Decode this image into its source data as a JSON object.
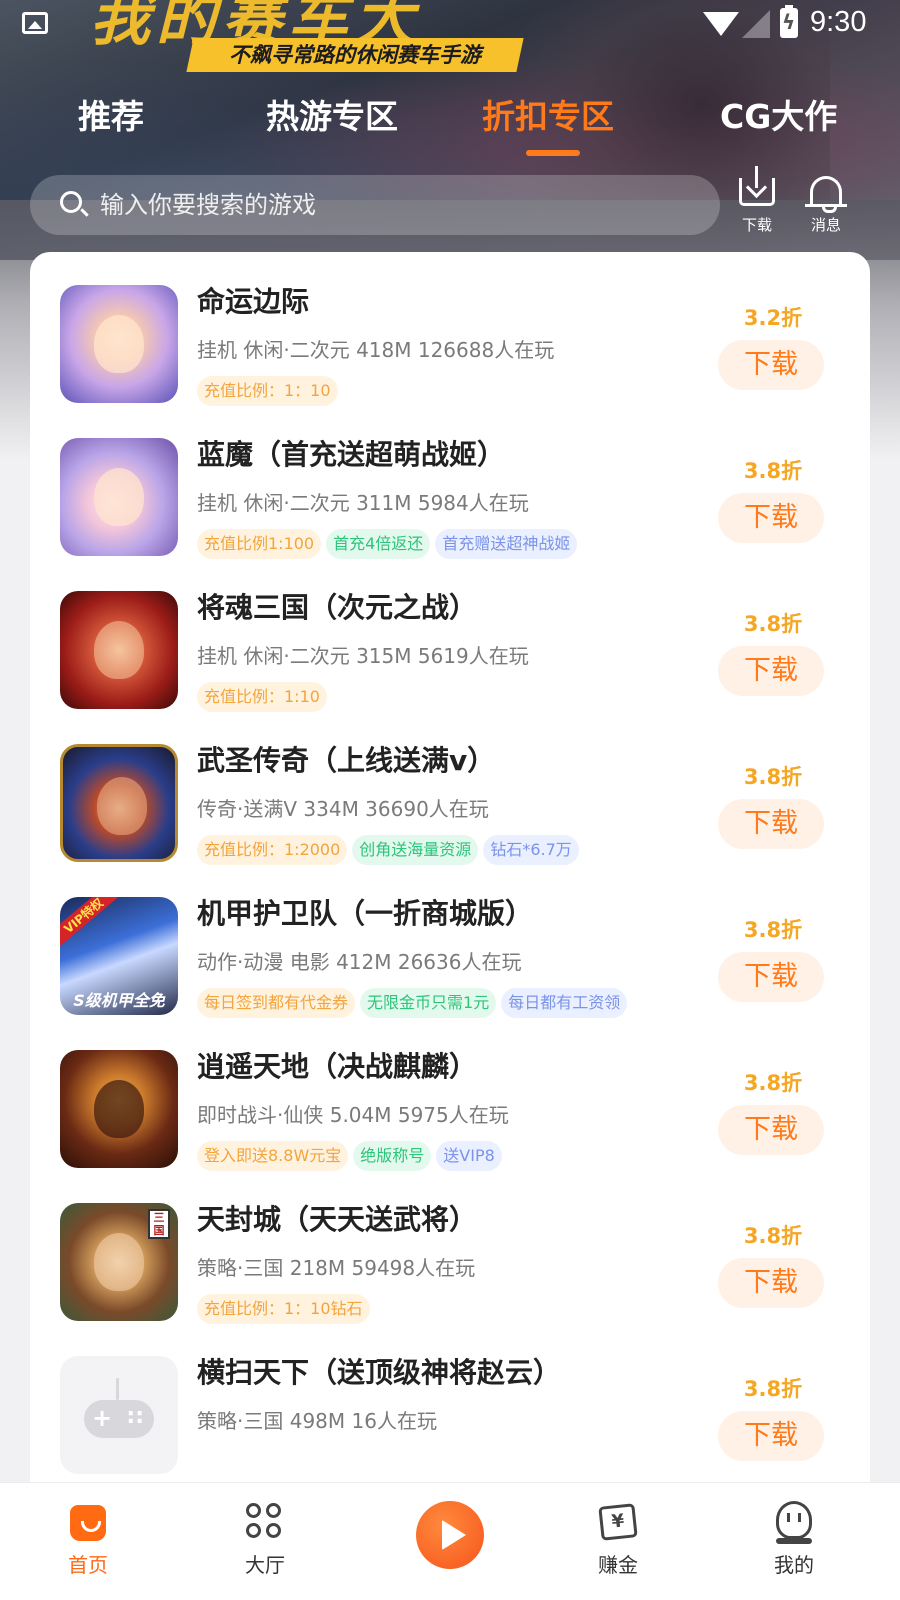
{
  "banner": {
    "art_title": "我的赛车大",
    "art_subtitle": "不飙寻常路的休闲赛车手游"
  },
  "status_bar": {
    "time": "9:30",
    "icons": [
      "image-icon",
      "wifi-icon",
      "signal-icon",
      "battery-charging-icon"
    ]
  },
  "top_tabs": [
    {
      "label": "推荐",
      "active": false
    },
    {
      "label": "热游专区",
      "active": false
    },
    {
      "label": "折扣专区",
      "active": true
    },
    {
      "label": "CG大作",
      "active": false
    }
  ],
  "search": {
    "placeholder": "输入你要搜索的游戏"
  },
  "header_actions": {
    "download_label": "下载",
    "messages_label": "消息"
  },
  "games": [
    {
      "name": "命运边际",
      "meta": "挂机 休闲·二次元  418M  126688人在玩",
      "discount": "3.2折",
      "button": "下载",
      "tags": [
        {
          "text": "充值比例：1：10",
          "color": "orange"
        }
      ]
    },
    {
      "name": "蓝魔（首充送超萌战姬）",
      "meta": "挂机 休闲·二次元  311M  5984人在玩",
      "discount": "3.8折",
      "button": "下载",
      "tags": [
        {
          "text": "充值比例1:100",
          "color": "orange"
        },
        {
          "text": "首充4倍返还",
          "color": "green"
        },
        {
          "text": "首充赠送超神战姬",
          "color": "blue"
        }
      ]
    },
    {
      "name": "将魂三国（次元之战）",
      "meta": "挂机 休闲·二次元  315M  5619人在玩",
      "discount": "3.8折",
      "button": "下载",
      "tags": [
        {
          "text": "充值比例：1:10",
          "color": "orange"
        }
      ]
    },
    {
      "name": "武圣传奇（上线送满v）",
      "meta": "传奇·送满V  334M  36690人在玩",
      "discount": "3.8折",
      "button": "下载",
      "tags": [
        {
          "text": "充值比例：1:2000",
          "color": "orange"
        },
        {
          "text": "创角送海量资源",
          "color": "green"
        },
        {
          "text": "钻石*6.7万",
          "color": "blue"
        }
      ]
    },
    {
      "name": "机甲护卫队（一折商城版）",
      "meta": "动作·动漫 电影  412M  26636人在玩",
      "discount": "3.8折",
      "button": "下载",
      "tags": [
        {
          "text": "每日签到都有代金券",
          "color": "orange"
        },
        {
          "text": "无限金币只需1元",
          "color": "green"
        },
        {
          "text": "每日都有工资领",
          "color": "blue"
        }
      ],
      "icon_art_text": "S级机甲全免",
      "icon_badge": "VIP特权"
    },
    {
      "name": "逍遥天地（决战麒麟）",
      "meta": "即时战斗·仙侠  5.04M  5975人在玩",
      "discount": "3.8折",
      "button": "下载",
      "tags": [
        {
          "text": "登入即送8.8W元宝",
          "color": "orange"
        },
        {
          "text": "绝版称号",
          "color": "green"
        },
        {
          "text": "送VIP8",
          "color": "blue"
        }
      ]
    },
    {
      "name": "天封城（天天送武将）",
      "meta": "策略·三国  218M  59498人在玩",
      "discount": "3.8折",
      "button": "下载",
      "tags": [
        {
          "text": "充值比例：1：10钻石",
          "color": "orange"
        }
      ],
      "icon_seal": "三国"
    },
    {
      "name": "横扫天下（送顶级神将赵云）",
      "meta": "策略·三国  498M  16人在玩",
      "discount": "3.8折",
      "button": "下载",
      "tags": []
    }
  ],
  "bottom_nav": [
    {
      "label": "首页",
      "icon": "home-icon",
      "active": true
    },
    {
      "label": "大厅",
      "icon": "hall-icon",
      "active": false
    },
    {
      "label": "",
      "icon": "play-icon",
      "active": false
    },
    {
      "label": "赚金",
      "icon": "earn-icon",
      "active": false
    },
    {
      "label": "我的",
      "icon": "mine-icon",
      "active": false
    }
  ],
  "colors": {
    "accent": "#ff7a1a",
    "discount": "#f5a623",
    "tag_orange": "#f3a43b",
    "tag_green": "#2cc57a",
    "tag_blue": "#7b93e8"
  }
}
